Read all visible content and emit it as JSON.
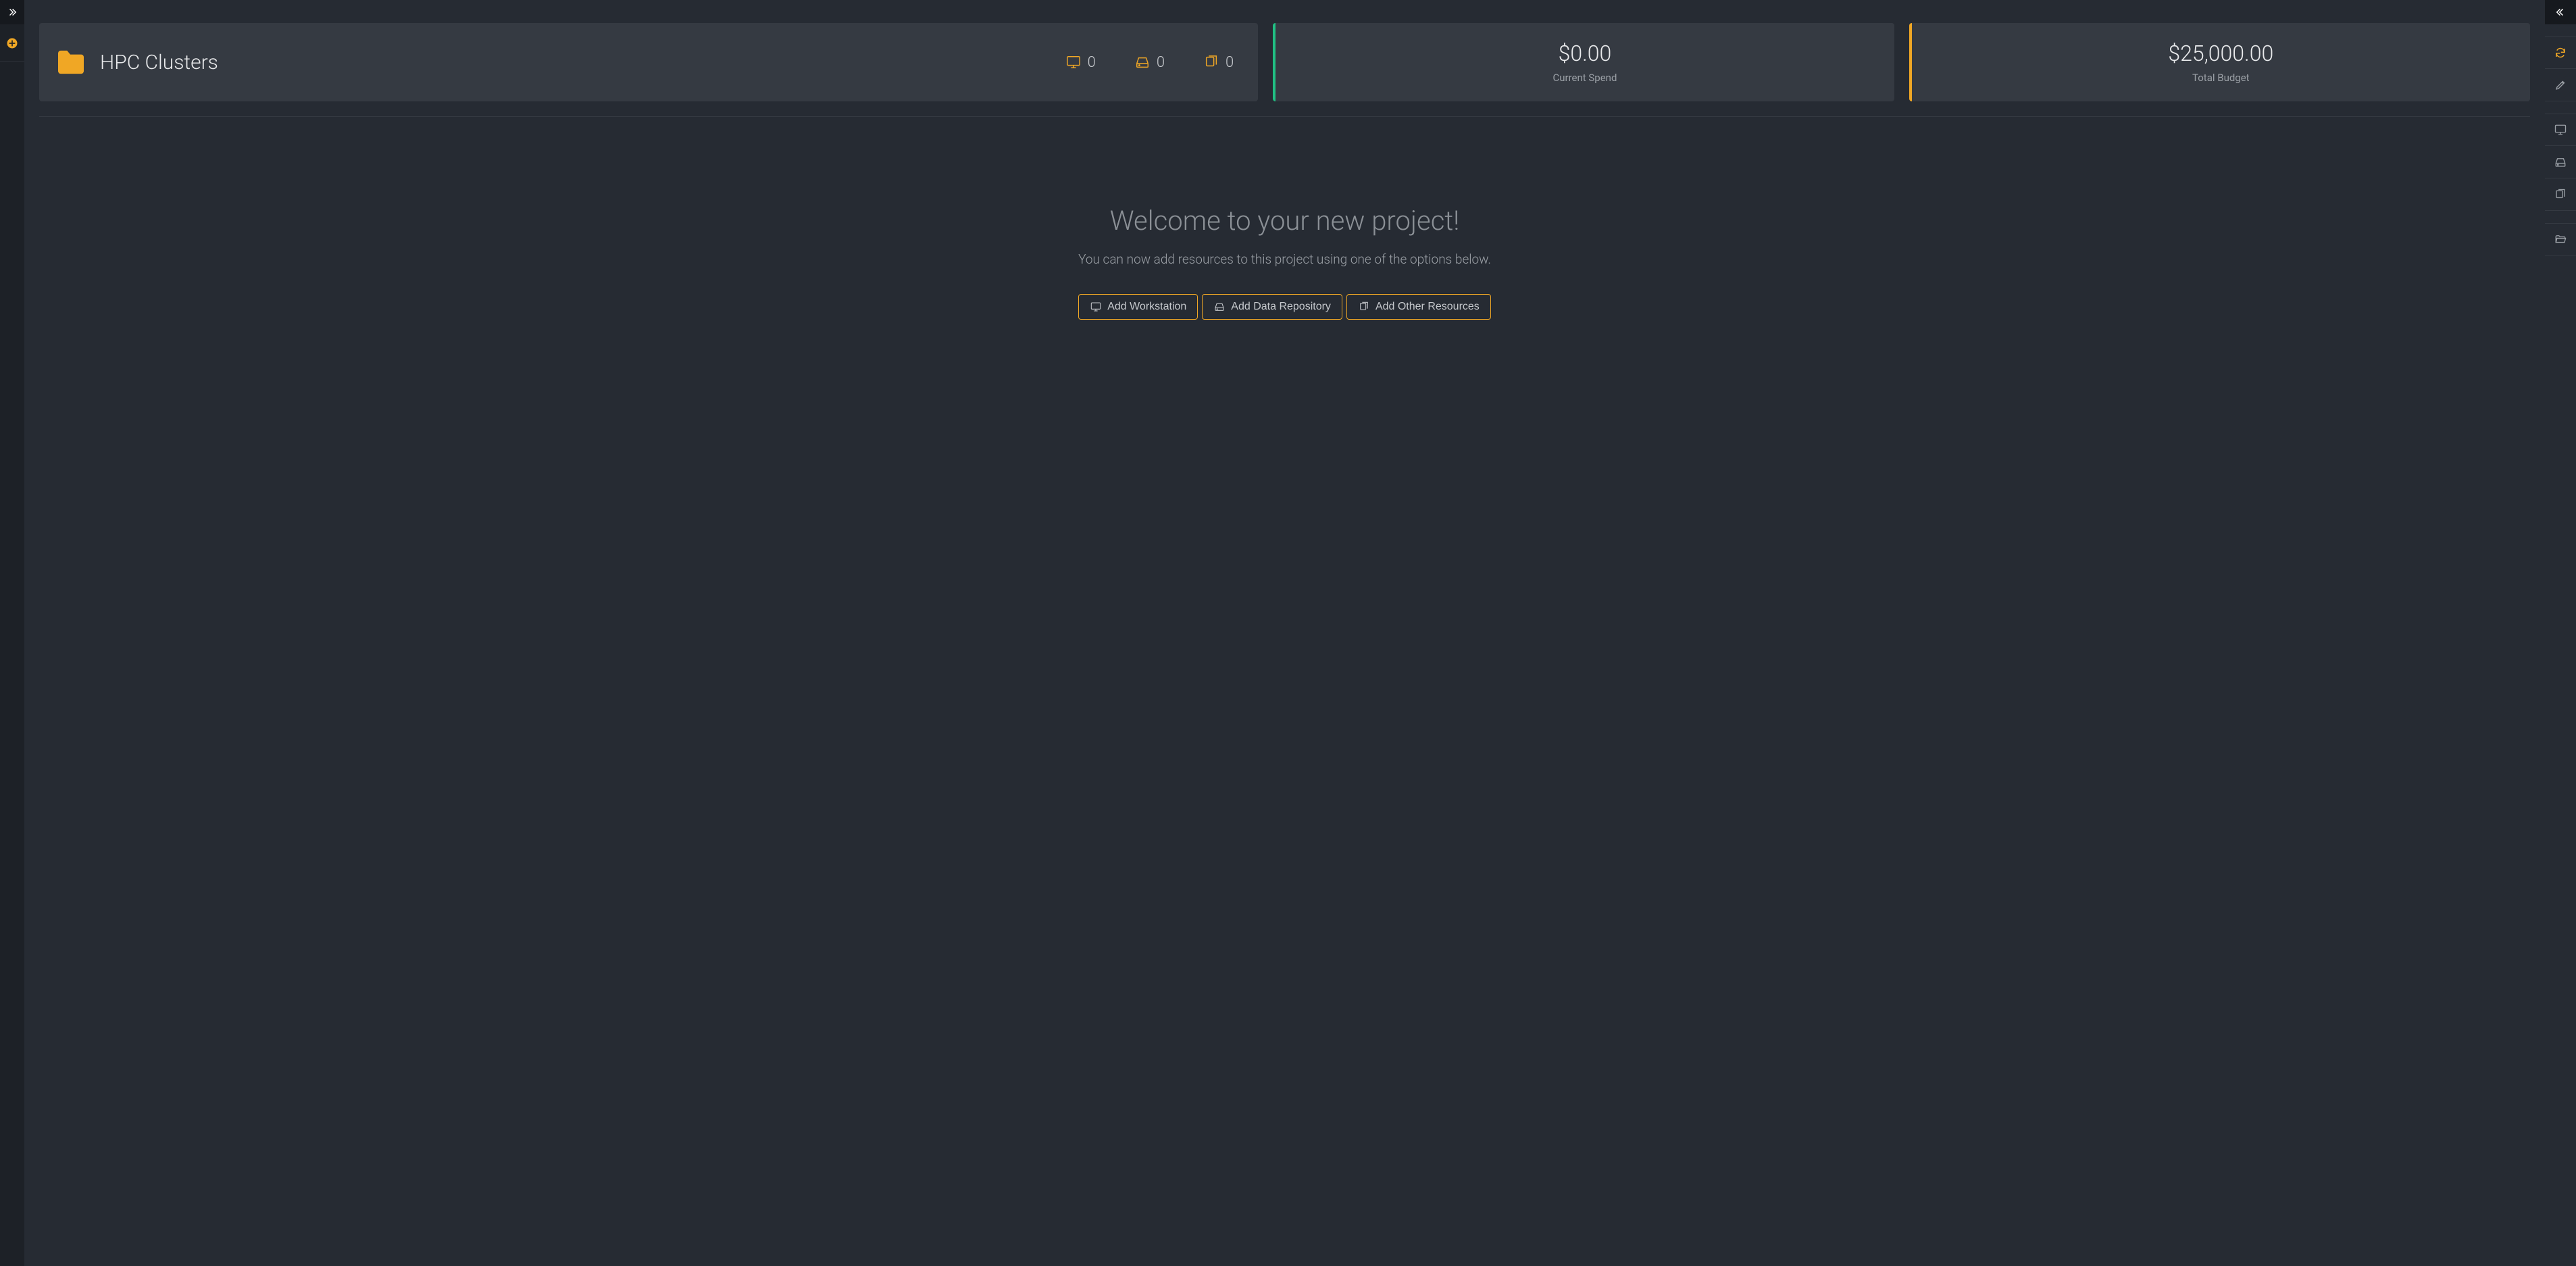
{
  "project": {
    "name": "HPC Clusters",
    "counts": {
      "workstations": "0",
      "storage": "0",
      "other": "0"
    }
  },
  "spend": {
    "value": "$0.00",
    "label": "Current Spend"
  },
  "budget": {
    "value": "$25,000.00",
    "label": "Total Budget"
  },
  "welcome": {
    "title": "Welcome to your new project!",
    "subtitle": "You can now add resources to this project using one of the options below."
  },
  "buttons": {
    "add_workstation": "Add Workstation",
    "add_data_repo": "Add Data Repository",
    "add_other": "Add Other Resources"
  },
  "colors": {
    "accent": "#f0a725",
    "success": "#20c083",
    "panel": "#353a42",
    "bg": "#262b33"
  }
}
